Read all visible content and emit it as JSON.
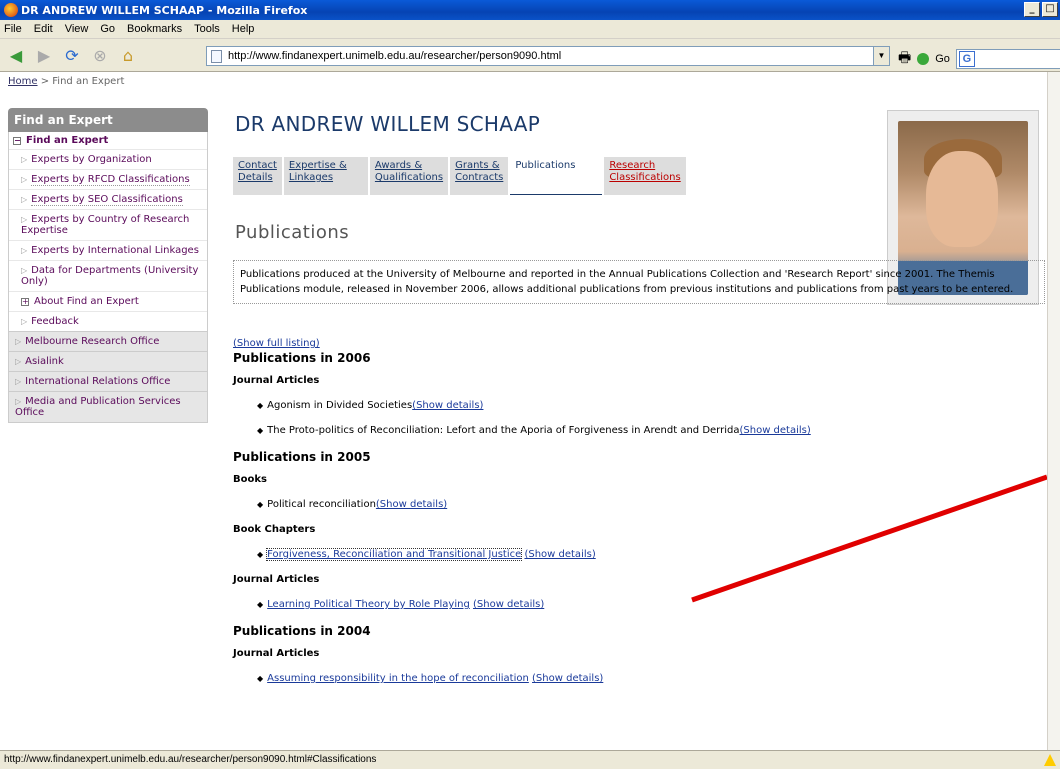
{
  "window": {
    "title": "DR ANDREW WILLEM SCHAAP - Mozilla Firefox"
  },
  "menu": {
    "items": [
      "File",
      "Edit",
      "View",
      "Go",
      "Bookmarks",
      "Tools",
      "Help"
    ]
  },
  "toolbar": {
    "url": "http://www.findanexpert.unimelb.edu.au/researcher/person9090.html",
    "go_label": "Go"
  },
  "breadcrumb": {
    "home": "Home",
    "sep": " > ",
    "current": "Find an Expert"
  },
  "sidebar": {
    "header": "Find an Expert",
    "sub_title": "Find an Expert",
    "items": [
      "Experts by Organization",
      "Experts by RFCD Classifications",
      "Experts by SEO Classifications",
      "Experts by Country of Research Expertise",
      "Experts by International Linkages",
      "Data for Departments (University Only)",
      "About Find an Expert",
      "Feedback"
    ],
    "main_items": [
      "Melbourne Research Office",
      "Asialink",
      "International Relations Office",
      "Media and Publication Services Office"
    ]
  },
  "person": {
    "name": "DR ANDREW WILLEM SCHAAP"
  },
  "tabs": [
    {
      "label_1": "Contact",
      "label_2": "Details"
    },
    {
      "label_1": "Expertise &",
      "label_2": "Linkages"
    },
    {
      "label_1": "Awards &",
      "label_2": "Qualifications"
    },
    {
      "label_1": "Grants &",
      "label_2": "Contracts"
    },
    {
      "label_1": "Publications",
      "label_2": ""
    },
    {
      "label_1": "Research",
      "label_2": "Classifications"
    }
  ],
  "section": {
    "title": "Publications"
  },
  "intro": {
    "text": "Publications produced at the University of Melbourne and reported in the Annual Publications Collection and 'Research Report' since 2001. The Themis Publications module, released in November 2006, allows additional publications from previous institutions and publications from past years to be entered."
  },
  "publications": {
    "show_full": "(Show full listing)",
    "show_details": "(Show details)",
    "y2006": {
      "heading": "Publications in 2006",
      "cat": "Journal Articles",
      "items": [
        "Agonism in Divided Societies",
        "The Proto-politics of Reconciliation: Lefort and the Aporia of Forgiveness in Arendt and Derrida"
      ]
    },
    "y2005": {
      "heading": "Publications in 2005",
      "cat_books": "Books",
      "book": "Political reconciliation",
      "cat_chapters": "Book Chapters",
      "chapter": "Forgiveness, Reconciliation and Transitional Justice",
      "cat_articles": "Journal Articles",
      "article": "Learning Political Theory by Role Playing"
    },
    "y2004": {
      "heading": "Publications in 2004",
      "cat": "Journal Articles",
      "item": "Assuming responsibility in the hope of reconciliation"
    }
  },
  "status": {
    "text": "http://www.findanexpert.unimelb.edu.au/researcher/person9090.html#Classifications"
  },
  "colors": {
    "title_bar": "#0643b3",
    "link": "#1a3a9a",
    "visited": "#5a0a5a",
    "annotation_arrow": "#e00000"
  }
}
